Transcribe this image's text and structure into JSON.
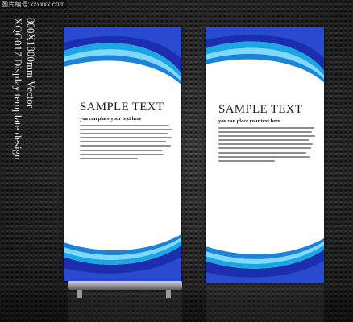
{
  "watermark": "图片编号:xxxxxx.com",
  "side_caption": {
    "line1": "XQG017 Display template design",
    "line2": "800X1800mm Vector"
  },
  "banners": [
    {
      "title": "SAMPLE TEXT",
      "subtitle": "you can place your text here",
      "colors": {
        "accent": "#1b2fae",
        "accent_light": "#19a6e3",
        "highlight": "#7fd8ff"
      }
    },
    {
      "title": "SAMPLE TEXT",
      "subtitle": "you can place your text here",
      "colors": {
        "accent": "#1b2fae",
        "accent_light": "#19a6e3",
        "highlight": "#7fd8ff"
      }
    }
  ]
}
